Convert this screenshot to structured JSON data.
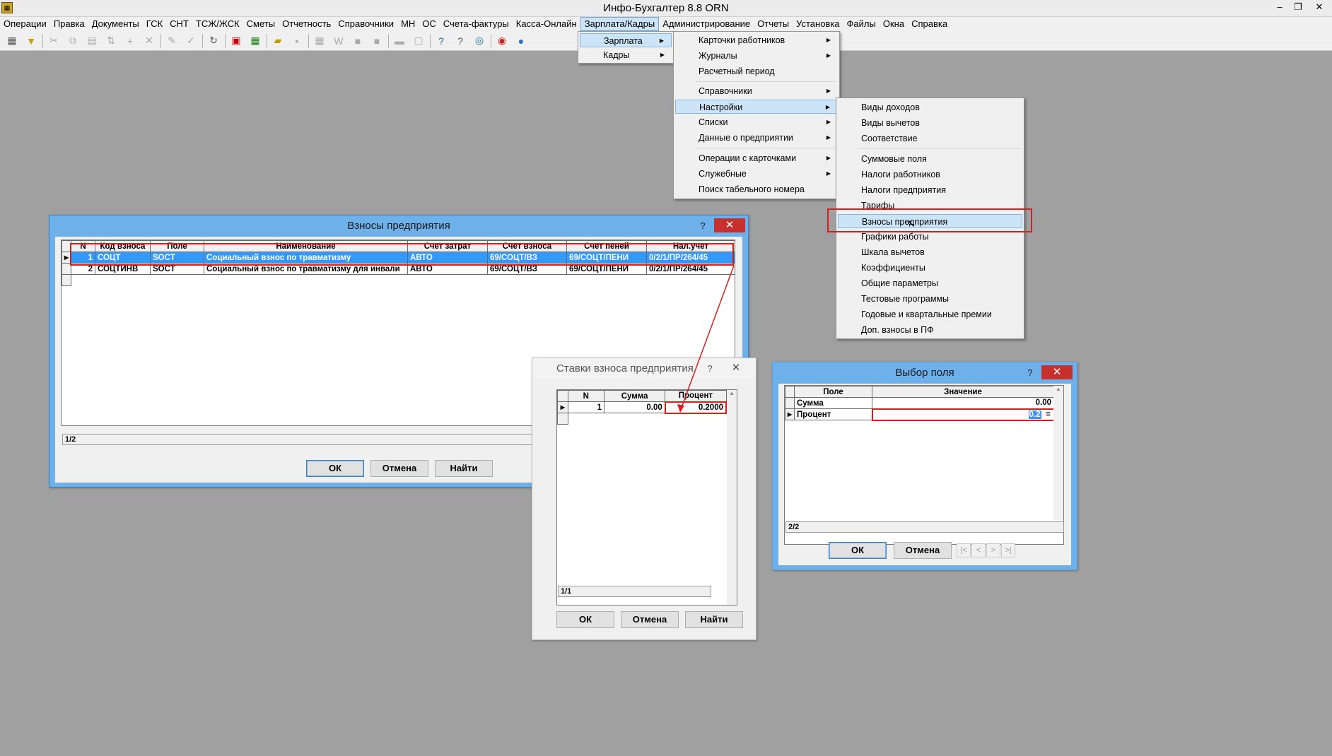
{
  "app": {
    "title": "Инфо-Бухгалтер 8.8   ORN"
  },
  "window_buttons": {
    "minimize": "–",
    "restore": "❐",
    "close": "✕"
  },
  "menubar": [
    "Операции",
    "Правка",
    "Документы",
    "ГСК",
    "СНТ",
    "ТСЖ/ЖСК",
    "Сметы",
    "Отчетность",
    "Справочники",
    "МН",
    "ОС",
    "Счета-фактуры",
    "Касса-Онлайн",
    "Зарплата/Кадры",
    "Администрирование",
    "Отчеты",
    "Установка",
    "Файлы",
    "Окна",
    "Справка"
  ],
  "menu_l1": {
    "items": [
      "Зарплата",
      "Кадры"
    ]
  },
  "menu_l2": {
    "items": [
      "Карточки работников",
      "Журналы",
      "Расчетный период",
      "Справочники",
      "Настройки",
      "Списки",
      "Данные о предприятии",
      "Операции с карточками",
      "Служебные",
      "Поиск табельного номера"
    ]
  },
  "menu_l3": {
    "items": [
      "Виды доходов",
      "Виды вычетов",
      "Соответствие",
      "Суммовые поля",
      "Налоги работников",
      "Налоги предприятия",
      "Тарифы",
      "Взносы предприятия",
      "Графики работы",
      "Шкала вычетов",
      "Коэффициенты",
      "Общие параметры",
      "Тестовые программы",
      "Годовые и квартальные премии",
      "Доп. взносы в ПФ"
    ]
  },
  "dlg_vznosy": {
    "title": "Взносы предприятия",
    "help": "?",
    "close": "✕",
    "columns": [
      "N",
      "Код взноса",
      "Поле",
      "Наименование",
      "Счет затрат",
      "Счет взноса",
      "Счет пеней",
      "Нал.учет"
    ],
    "rows": [
      [
        "1",
        "СОЦТ",
        "SOCT",
        "Социальный взнос по травматизму",
        "АВТО",
        "69/СОЦТ/ВЗ",
        "69/СОЦТ/ПЕНИ",
        "0/2/1/ПР/264/45"
      ],
      [
        "2",
        "СОЦТИНВ",
        "SOCT",
        "Социальный взнос по травматизму для инвали",
        "АВТО",
        "69/СОЦТ/ВЗ",
        "69/СОЦТ/ПЕНИ",
        "0/2/1/ПР/264/45"
      ]
    ],
    "status": "1/2",
    "ok": "ОК",
    "cancel": "Отмена",
    "find": "Найти"
  },
  "dlg_stavki": {
    "title": "Ставки взноса предприятия",
    "help": "?",
    "close": "✕",
    "columns": [
      "N",
      "Сумма",
      "Процент"
    ],
    "rows": [
      [
        "1",
        "0.00",
        "0.2000"
      ]
    ],
    "status": "1/1",
    "ok": "ОК",
    "cancel": "Отмена",
    "find": "Найти"
  },
  "dlg_vybor": {
    "title": "Выбор поля",
    "help": "?",
    "close": "✕",
    "columns": [
      "Поле",
      "Значение"
    ],
    "rows": [
      [
        "Сумма",
        "0.00"
      ],
      [
        "Процент",
        "0.2"
      ]
    ],
    "edit_button": "=",
    "status": "2/2",
    "ok": "ОК",
    "cancel": "Отмена",
    "nav": [
      "|<",
      "<",
      ">",
      ">|"
    ]
  }
}
